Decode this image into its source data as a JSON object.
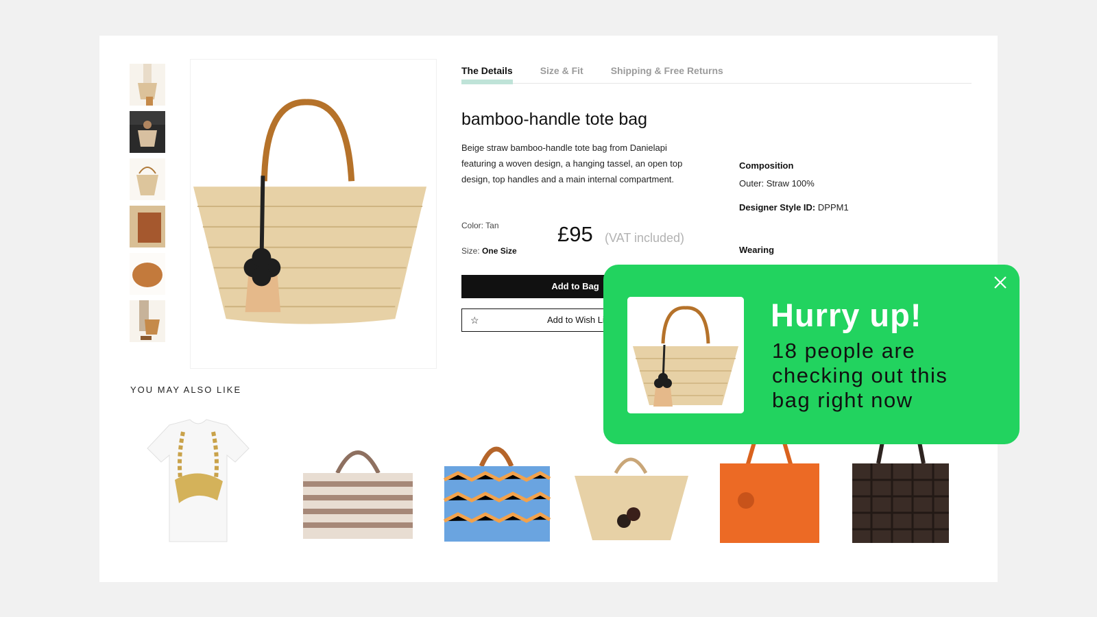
{
  "tabs": [
    {
      "label": "The Details"
    },
    {
      "label": "Size & Fit"
    },
    {
      "label": "Shipping & Free Returns"
    }
  ],
  "product": {
    "title": "bamboo-handle tote bag",
    "description": "Beige straw bamboo-handle tote bag from Danielapi featuring a woven design, a hanging tassel, an open top design, top handles and a main internal compartment.",
    "color_label": "Color:",
    "color_value": "Tan",
    "size_label": "Size:",
    "size_value": "One Size",
    "price": "£95",
    "vat_note": "(VAT included)",
    "add_to_bag": "Add to Bag",
    "add_to_wishlist": "Add to Wish List",
    "composition_heading": "Composition",
    "composition_value": "Outer: Straw 100%",
    "style_id_label": "Designer Style ID:",
    "style_id_value": "DPPM1",
    "wearing_heading": "Wearing"
  },
  "recommendations": {
    "heading": "YOU MAY ALSO LIKE",
    "items": [
      {
        "icon": "moschino-tshirt-image"
      },
      {
        "icon": "striped-tote-image"
      },
      {
        "icon": "blue-pattern-tote-image"
      },
      {
        "icon": "straw-tote-image"
      },
      {
        "icon": "orange-tote-image"
      },
      {
        "icon": "woven-brown-tote-image"
      }
    ]
  },
  "popup": {
    "title": "Hurry up!",
    "message": "18 people are checking out this bag right now",
    "background": "#22d35f"
  },
  "colors": {
    "tab_underline": "#bfe3d8",
    "button_dark": "#111111"
  }
}
